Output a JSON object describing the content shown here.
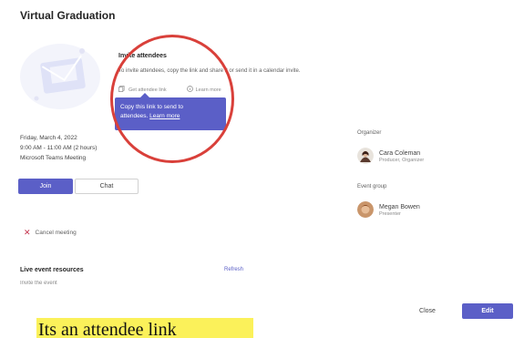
{
  "dialog": {
    "title": "Virtual Graduation"
  },
  "invite": {
    "heading": "Invite attendees",
    "description": "To invite attendees, copy the link and share it or send it in a calendar invite.",
    "copy_link_label": "Get attendee link",
    "learn_more_label": "Learn more"
  },
  "tooltip": {
    "line1": "Copy this link to send to",
    "line2_prefix": "attendees.",
    "learn_more": "Learn more"
  },
  "meeting": {
    "date": "Friday, March 4, 2022",
    "time": "9:00 AM - 11:00 AM (2 hours)",
    "location": "Microsoft Teams Meeting"
  },
  "actions": {
    "join_label": "Join",
    "chat_label": "Chat",
    "cancel_label": "Cancel meeting"
  },
  "resources": {
    "heading": "Live event resources",
    "refresh_label": "Refresh",
    "cut_text": "Invite the event"
  },
  "organizer": {
    "label": "Organizer",
    "name": "Cara Coleman",
    "role": "Producer, Organizer"
  },
  "event_group": {
    "label": "Event group",
    "name": "Megan Bowen",
    "role": "Presenter"
  },
  "footer": {
    "close_label": "Close",
    "edit_label": "Edit"
  },
  "caption": {
    "text": "Its an attendee link"
  },
  "colors": {
    "accent": "#5b5fc7",
    "highlight_circle": "#d9403a",
    "caption_bg": "#fbf15a",
    "cancel_icon": "#c4314b"
  },
  "icons": {
    "illustration": "envelope-illustration-icon",
    "copy": "copy-icon",
    "info": "info-icon",
    "cancel": "close-icon"
  }
}
